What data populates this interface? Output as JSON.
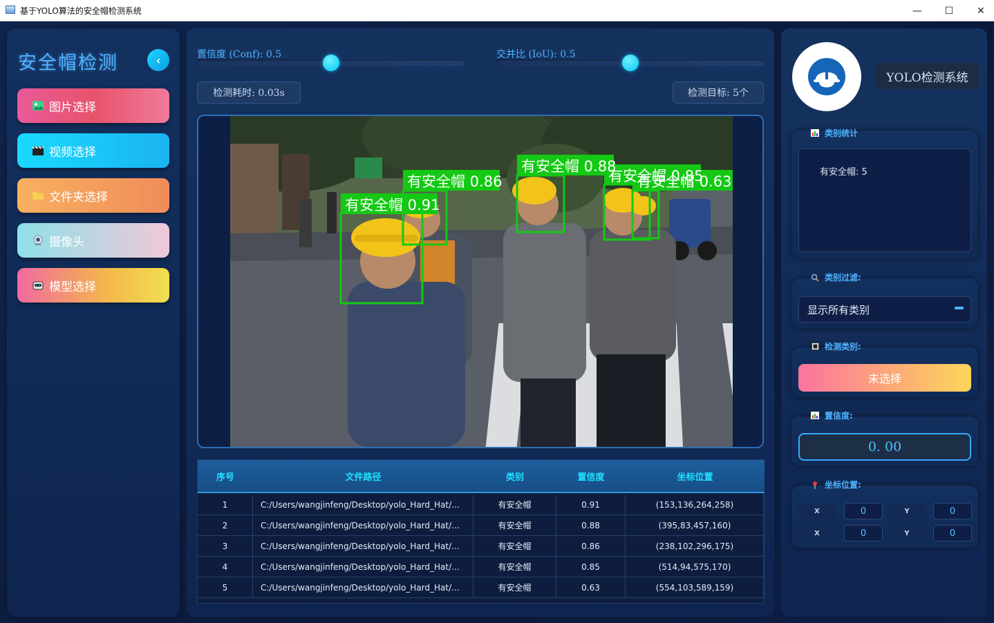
{
  "window": {
    "title": "基于YOLO算法的安全帽检测系统",
    "min_glyph": "—",
    "max_glyph": "☐",
    "close_glyph": "✕"
  },
  "sidebar": {
    "brand": "安全帽检测",
    "collapse_icon": "chevron-left-icon",
    "collapse_glyph": "‹",
    "items": [
      {
        "label": "图片选择",
        "icon": "image-icon"
      },
      {
        "label": "视频选择",
        "icon": "clapper-icon"
      },
      {
        "label": "文件夹选择",
        "icon": "folder-icon"
      },
      {
        "label": "摄像头",
        "icon": "webcam-icon"
      },
      {
        "label": "模型选择",
        "icon": "robot-icon"
      }
    ]
  },
  "controls": {
    "conf_label": "置信度 (Conf): 0.5",
    "conf_value": 0.5,
    "iou_label": "交并比 (IoU): 0.5",
    "iou_value": 0.5,
    "time_text": "检测耗时: 0.03s",
    "target_text": "检测目标: 5个"
  },
  "detections": [
    {
      "label": "有安全帽 0.91"
    },
    {
      "label": "有安全帽 0.88"
    },
    {
      "label": "有安全帽 0.86"
    },
    {
      "label": "有安全帽 0.85"
    },
    {
      "label": "有安全帽 0.63"
    }
  ],
  "table": {
    "headers": [
      "序号",
      "文件路径",
      "类别",
      "置信度",
      "坐标位置"
    ],
    "rows": [
      [
        "1",
        "C:/Users/wangjinfeng/Desktop/yolo_Hard_Hat/...",
        "有安全帽",
        "0.91",
        "(153,136,264,258)"
      ],
      [
        "2",
        "C:/Users/wangjinfeng/Desktop/yolo_Hard_Hat/...",
        "有安全帽",
        "0.88",
        "(395,83,457,160)"
      ],
      [
        "3",
        "C:/Users/wangjinfeng/Desktop/yolo_Hard_Hat/...",
        "有安全帽",
        "0.86",
        "(238,102,296,175)"
      ],
      [
        "4",
        "C:/Users/wangjinfeng/Desktop/yolo_Hard_Hat/...",
        "有安全帽",
        "0.85",
        "(514,94,575,170)"
      ],
      [
        "5",
        "C:/Users/wangjinfeng/Desktop/yolo_Hard_Hat/...",
        "有安全帽",
        "0.63",
        "(554,103,589,159)"
      ]
    ]
  },
  "right_panel": {
    "logo_icon": "hard-hat-icon",
    "system_title": "YOLO检测系统",
    "stats_label": "类别统计",
    "stats_text": "有安全帽: 5",
    "filter_label": "类别过滤:",
    "filter_value": "显示所有类别",
    "detect_class_label": "检测类别:",
    "detect_class_button": "未选择",
    "conf_label": "置信度:",
    "conf_display": "0. 00",
    "coord_label": "坐标位置:",
    "coords": [
      {
        "label": "X",
        "value": "0"
      },
      {
        "label": "Y",
        "value": "0"
      },
      {
        "label": "X",
        "value": "0"
      },
      {
        "label": "Y",
        "value": "0"
      }
    ]
  },
  "colors": {
    "accent": "#4fb4ff",
    "cyan": "#1fe0ff",
    "bg": "#0b1a3a",
    "box_green": "#14c814"
  }
}
